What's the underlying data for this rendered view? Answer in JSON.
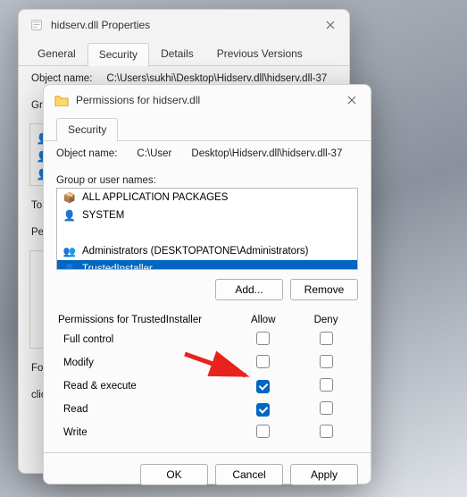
{
  "back": {
    "title": "hidserv.dll Properties",
    "tabs": [
      "General",
      "Security",
      "Details",
      "Previous Versions"
    ],
    "active": 1,
    "obj_lbl": "Object name:",
    "obj_val": "C:\\Users\\sukhi\\Desktop\\Hidserv.dll\\hidserv.dll-37",
    "grp_short": "Gr",
    "to_short": "To",
    "pe_short": "Pe",
    "for_short": "Fo",
    "click_short": "click"
  },
  "dlg": {
    "title": "Permissions for hidserv.dll",
    "tab": "Security",
    "obj_lbl": "Object name:",
    "obj_path_a": "C:\\User",
    "obj_path_b": "Desktop\\Hidserv.dll\\hidserv.dll-37",
    "groups_lbl": "Group or user names:",
    "groups": [
      {
        "icon": "pkg",
        "label": "ALL APPLICATION PACKAGES"
      },
      {
        "icon": "user",
        "label": "SYSTEM"
      },
      {
        "icon": "blank",
        "label": ""
      },
      {
        "icon": "grp",
        "label": "Administrators (DESKTOPATONE\\Administrators)"
      },
      {
        "icon": "user",
        "label": "TrustedInstaller",
        "selected": true
      }
    ],
    "add": "Add...",
    "remove": "Remove",
    "perm_for": "Permissions for TrustedInstaller",
    "allow": "Allow",
    "deny": "Deny",
    "perms": [
      {
        "name": "Full control",
        "a": false,
        "d": false
      },
      {
        "name": "Modify",
        "a": false,
        "d": false
      },
      {
        "name": "Read & execute",
        "a": true,
        "d": false
      },
      {
        "name": "Read",
        "a": true,
        "d": false
      },
      {
        "name": "Write",
        "a": false,
        "d": false
      }
    ],
    "ok": "OK",
    "cancel": "Cancel",
    "apply": "Apply"
  }
}
